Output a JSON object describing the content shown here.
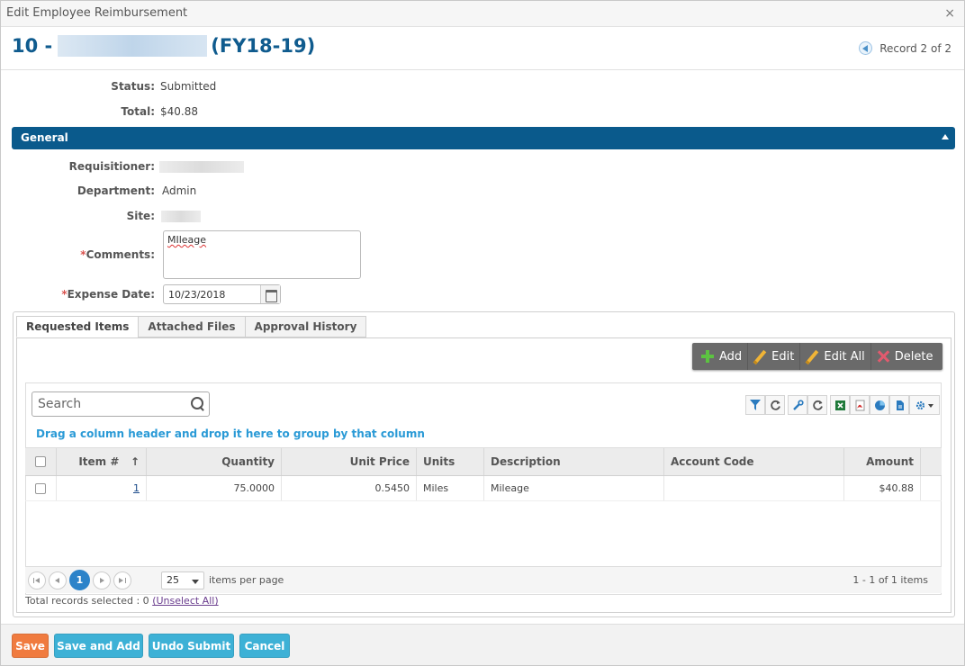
{
  "window": {
    "title": "Edit Employee Reimbursement",
    "close_glyph": "×"
  },
  "record": {
    "prefix": "10 -",
    "fiscal_year": "(FY18-19)",
    "nav_text": "Record 2 of 2"
  },
  "summary": {
    "status_label": "Status:",
    "status_value": "Submitted",
    "total_label": "Total:",
    "total_value": "$40.88"
  },
  "general": {
    "section_title": "General",
    "requisitioner_label": "Requisitioner:",
    "department_label": "Department:",
    "department_value": "Admin",
    "site_label": "Site:",
    "comments_label": "Comments:",
    "comments_value": "MIleage",
    "expense_date_label": "Expense Date:",
    "expense_date_value": "10/23/2018",
    "required_marker": "*"
  },
  "tabs": [
    {
      "label": "Requested Items",
      "active": true
    },
    {
      "label": "Attached Files",
      "active": false
    },
    {
      "label": "Approval History",
      "active": false
    }
  ],
  "toolbar": {
    "add": "Add",
    "edit": "Edit",
    "edit_all": "Edit All",
    "delete": "Delete"
  },
  "grid": {
    "search_placeholder": "Search",
    "group_hint": "Drag a column header and drop it here to group by that column",
    "sort_indicator": "↑",
    "columns": [
      "Item #",
      "Quantity",
      "Unit Price",
      "Units",
      "Description",
      "Account Code",
      "Amount"
    ],
    "rows": [
      {
        "item": "1",
        "quantity": "75.0000",
        "unit_price": "0.5450",
        "units": "Miles",
        "description": "Mileage",
        "account_code": "",
        "amount": "$40.88"
      }
    ],
    "tool_icons": [
      "filter-icon",
      "refresh-icon",
      "wrench-icon",
      "reset-icon",
      "excel-icon",
      "pdf-icon",
      "chart-icon",
      "document-icon",
      "settings-icon"
    ]
  },
  "pager": {
    "current_page": "1",
    "page_size": "25",
    "per_page_text": "items per page",
    "info": "1 - 1 of 1 items"
  },
  "selection": {
    "text": "Total records selected : 0",
    "unselect": "(Unselect All)"
  },
  "footer": {
    "save": "Save",
    "save_and_add": "Save and Add",
    "undo_submit": "Undo Submit",
    "cancel": "Cancel",
    "colors": {
      "save": "#f07b3f",
      "secondary": "#3db1d6"
    }
  },
  "colors": {
    "accent": "#0a5a8c",
    "title": "#0f5b8e",
    "link": "#2a9ad6"
  }
}
